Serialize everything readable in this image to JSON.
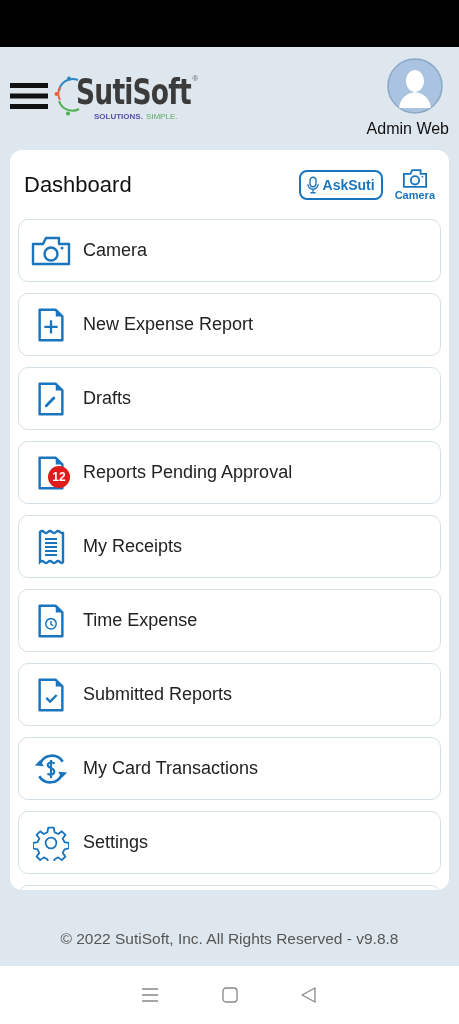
{
  "header": {
    "logo": {
      "name": "SutiSoft",
      "mark": "®",
      "tagline_1": "SOLUTIONS.",
      "tagline_2": "SIMPLE."
    },
    "user": {
      "name": "Admin Web"
    }
  },
  "dashboard": {
    "title": "Dashboard",
    "ask_button": "AskSuti",
    "camera_button": "Camera",
    "items": [
      {
        "kind": "camera",
        "label": "Camera"
      },
      {
        "kind": "doc-plus",
        "label": "New Expense Report"
      },
      {
        "kind": "doc-pen",
        "label": "Drafts"
      },
      {
        "kind": "doc-badge",
        "label": "Reports Pending Approval",
        "badge": "12"
      },
      {
        "kind": "receipt",
        "label": "My Receipts"
      },
      {
        "kind": "doc-clock",
        "label": "Time Expense"
      },
      {
        "kind": "doc-check",
        "label": "Submitted Reports"
      },
      {
        "kind": "exchange",
        "label": "My Card Transactions"
      },
      {
        "kind": "gear",
        "label": "Settings"
      }
    ]
  },
  "footer": "© 2022 SutiSoft, Inc. All Rights Reserved - v9.8.8"
}
